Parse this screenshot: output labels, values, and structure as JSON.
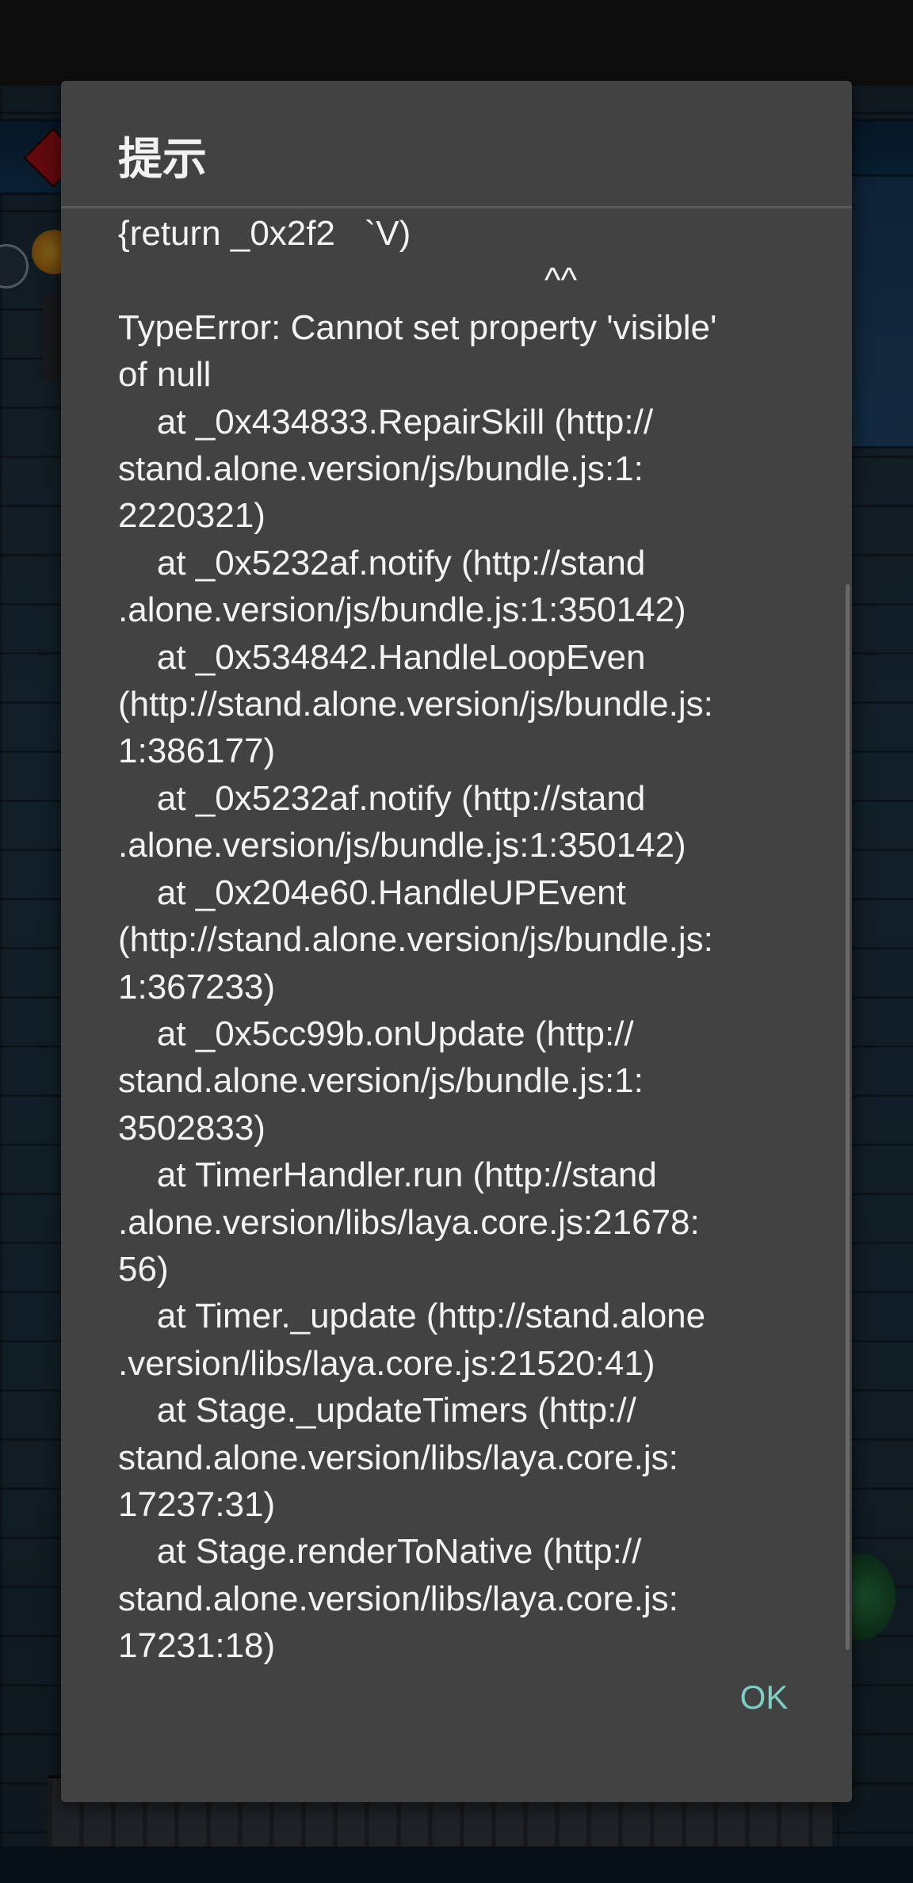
{
  "dialog": {
    "title": "提示",
    "message": "{return _0x2f2   `V)\n                                            ^^\nTypeError: Cannot set property 'visible'\nof null\n    at _0x434833.RepairSkill (http://\nstand.alone.version/js/bundle.js:1:\n2220321)\n    at _0x5232af.notify (http://stand\n.alone.version/js/bundle.js:1:350142)\n    at _0x534842.HandleLoopEven\n(http://stand.alone.version/js/bundle.js:\n1:386177)\n    at _0x5232af.notify (http://stand\n.alone.version/js/bundle.js:1:350142)\n    at _0x204e60.HandleUPEvent\n(http://stand.alone.version/js/bundle.js:\n1:367233)\n    at _0x5cc99b.onUpdate (http://\nstand.alone.version/js/bundle.js:1:\n3502833)\n    at TimerHandler.run (http://stand\n.alone.version/libs/laya.core.js:21678:\n56)\n    at Timer._update (http://stand.alone\n.version/libs/laya.core.js:21520:41)\n    at Stage._updateTimers (http://\nstand.alone.version/libs/laya.core.js:\n17237:31)\n    at Stage.renderToNative (http://\nstand.alone.version/libs/laya.core.js:\n17231:18)",
    "ok_label": "OK"
  },
  "colors": {
    "dialog_background": "#424242",
    "title_text": "#f2f2f2",
    "message_text": "#f3f3f3",
    "ok_accent": "#7ecec4"
  }
}
